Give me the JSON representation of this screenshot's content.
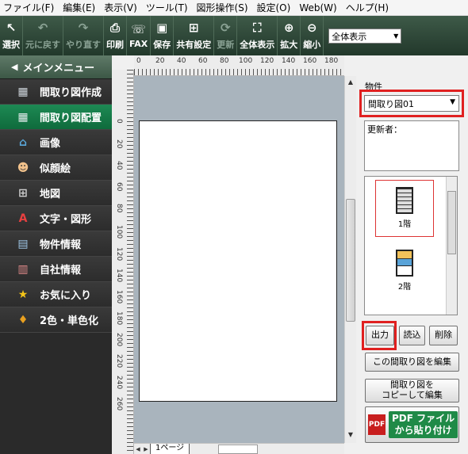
{
  "menu": [
    "ファイル(F)",
    "編集(E)",
    "表示(V)",
    "ツール(T)",
    "図形操作(S)",
    "設定(O)",
    "Web(W)",
    "ヘルプ(H)"
  ],
  "toolbar": {
    "items": [
      {
        "label": "選択",
        "icon": "cursor-icon"
      },
      {
        "label": "元に戻す",
        "icon": "undo-icon"
      },
      {
        "label": "やり直す",
        "icon": "redo-icon"
      },
      {
        "label": "印刷",
        "icon": "printer-icon"
      },
      {
        "label": "FAX",
        "icon": "fax-icon"
      },
      {
        "label": "保存",
        "icon": "save-icon"
      },
      {
        "label": "共有設定",
        "icon": "share-icon"
      },
      {
        "label": "更新",
        "icon": "refresh-icon"
      },
      {
        "label": "全体表示",
        "icon": "fit-view-icon"
      },
      {
        "label": "拡大",
        "icon": "zoom-in-icon"
      },
      {
        "label": "縮小",
        "icon": "zoom-out-icon"
      }
    ],
    "zoom_select": "全体表示"
  },
  "sidebar": {
    "header": "メインメニュー",
    "items": [
      {
        "label": "間取り図作成",
        "icon": "floorplan-create-icon"
      },
      {
        "label": "間取り図配置",
        "icon": "floorplan-layout-icon"
      },
      {
        "label": "画像",
        "icon": "image-icon"
      },
      {
        "label": "似顔絵",
        "icon": "portrait-icon"
      },
      {
        "label": "地図",
        "icon": "map-icon"
      },
      {
        "label": "文字・図形",
        "icon": "text-shape-icon"
      },
      {
        "label": "物件情報",
        "icon": "property-info-icon"
      },
      {
        "label": "自社情報",
        "icon": "company-info-icon"
      },
      {
        "label": "お気に入り",
        "icon": "star-icon"
      },
      {
        "label": "2色・単色化",
        "icon": "color-mode-icon"
      }
    ]
  },
  "rulers": {
    "h": [
      "0",
      "20",
      "40",
      "60",
      "80",
      "100",
      "120",
      "140",
      "160",
      "180"
    ],
    "v": [
      "0",
      "20",
      "40",
      "60",
      "80",
      "100",
      "120",
      "140",
      "160",
      "180",
      "200",
      "220",
      "240",
      "260"
    ]
  },
  "page_tab": "1ページ",
  "right": {
    "property_label": "物件",
    "plan_select": "間取り図01",
    "updater_label": "更新者：",
    "thumbs": [
      "1階",
      "2階"
    ],
    "buttons": {
      "output": "出力",
      "load": "読込",
      "delete": "削除",
      "edit": "この間取り図を編集",
      "copy_edit": "間取り図を\nコピーして編集"
    },
    "pdf_badge": "PDF",
    "pdf_text": "PDF ファイル\nから貼り付け"
  }
}
